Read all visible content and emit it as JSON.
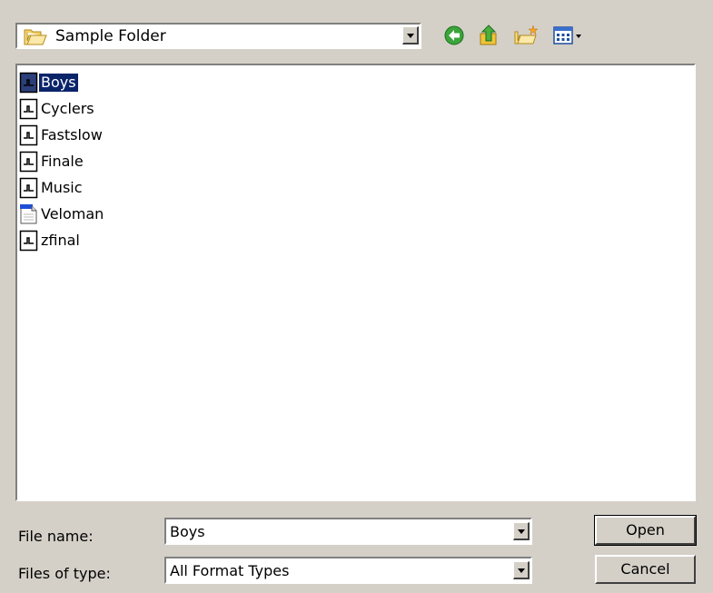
{
  "look_in": {
    "value": "Sample Folder",
    "folder_icon": "folder-open-icon"
  },
  "toolbar": {
    "back_icon": "back-arrow-icon",
    "up_icon": "up-folder-icon",
    "new_folder_icon": "new-folder-icon",
    "views_icon": "views-menu-icon"
  },
  "files": [
    {
      "name": "Boys",
      "icon": "audio-file-icon",
      "selected": true
    },
    {
      "name": "Cyclers",
      "icon": "audio-file-icon",
      "selected": false
    },
    {
      "name": "Fastslow",
      "icon": "audio-file-icon",
      "selected": false
    },
    {
      "name": "Finale",
      "icon": "audio-file-icon",
      "selected": false
    },
    {
      "name": "Music",
      "icon": "audio-file-icon",
      "selected": false
    },
    {
      "name": "Veloman",
      "icon": "document-file-icon",
      "selected": false
    },
    {
      "name": "zfinal",
      "icon": "audio-file-icon",
      "selected": false
    }
  ],
  "file_name": {
    "label": "File name:",
    "value": "Boys"
  },
  "file_type": {
    "label": "Files of type:",
    "value": "All Format Types"
  },
  "buttons": {
    "open": "Open",
    "cancel": "Cancel"
  },
  "colors": {
    "dialog_bg": "#d4d0c8",
    "selection": "#0a246a"
  }
}
